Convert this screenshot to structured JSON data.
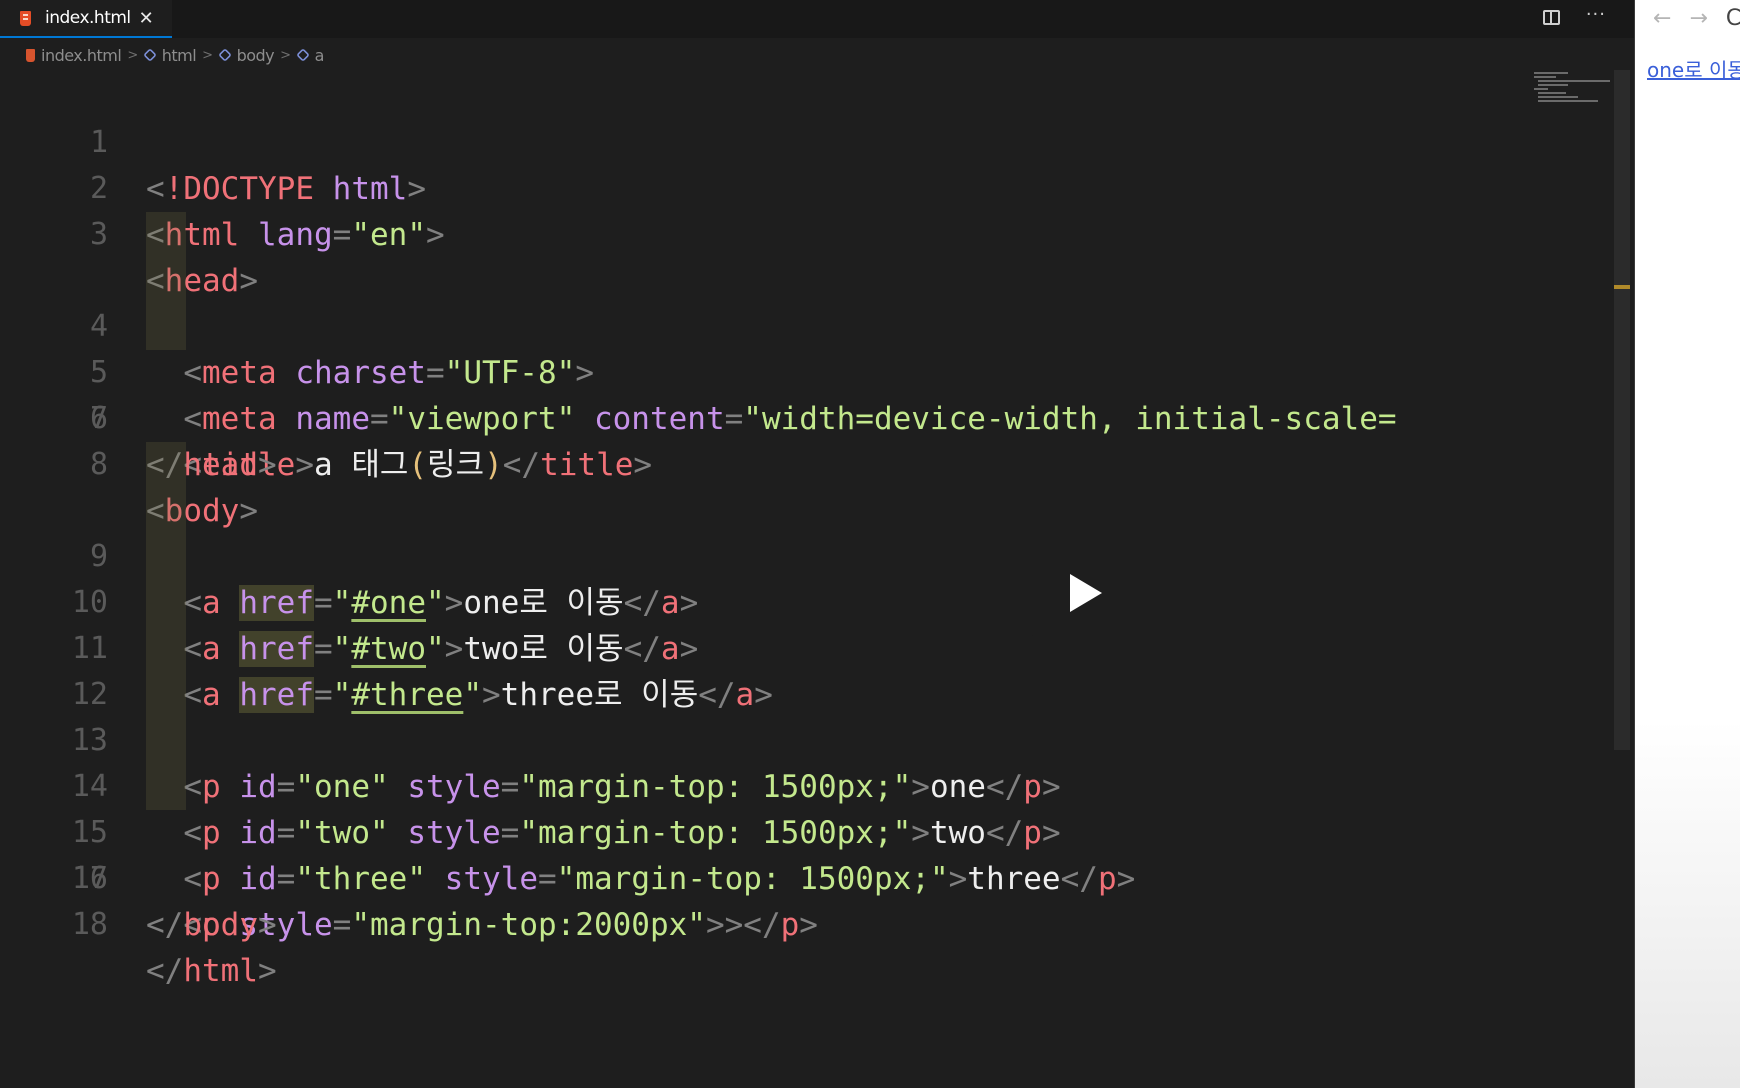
{
  "tab": {
    "filename": "index.html",
    "close_glyph": "✕"
  },
  "actions": {
    "more_glyph": "···"
  },
  "breadcrumb": {
    "file": "index.html",
    "items": [
      "html",
      "body",
      "a"
    ],
    "separator": ">"
  },
  "lines": {
    "n1": "1",
    "n2": "2",
    "n3": "3",
    "n4": "4",
    "n5": "5",
    "n6": "6",
    "n7": "7",
    "n8": "8",
    "n9": "9",
    "n10": "10",
    "n11": "11",
    "n12": "12",
    "n13": "13",
    "n14": "14",
    "n15": "15",
    "n16": "16",
    "n17": "17",
    "n18": "18"
  },
  "code": {
    "l1": {
      "lt": "<",
      "bang": "!",
      "doctype": "DOCTYPE",
      "sp": " ",
      "html": "html",
      "gt": ">"
    },
    "l2": {
      "lt": "<",
      "tag": "html",
      "sp": " ",
      "attr": "lang",
      "eq": "=",
      "val": "\"en\"",
      "gt": ">"
    },
    "l3": {
      "lt": "<",
      "tag": "head",
      "gt": ">"
    },
    "l4": {
      "lt": "<",
      "tag": "meta",
      "sp": " ",
      "attr": "charset",
      "eq": "=",
      "val": "\"UTF-8\"",
      "gt": ">"
    },
    "l5": {
      "lt": "<",
      "tag": "meta",
      "sp1": " ",
      "attr1": "name",
      "eq1": "=",
      "val1": "\"viewport\"",
      "sp2": " ",
      "attr2": "content",
      "eq2": "=",
      "val2": "\"width=device-width, initial-scale="
    },
    "l6": {
      "lt": "<",
      "tag": "title",
      "gt": ">",
      "text1": "a 태그",
      "paren_open": "(",
      "text2": "링크",
      "paren_close": ")",
      "clt": "</",
      "ctag": "title",
      "cgt": ">"
    },
    "l7": {
      "clt": "</",
      "tag": "head",
      "gt": ">"
    },
    "l8": {
      "lt": "<",
      "tag": "body",
      "gt": ">"
    },
    "l9": {
      "lt": "<",
      "tag": "a",
      "sp": " ",
      "attr": "href",
      "eq": "=",
      "q1": "\"",
      "link": "#one",
      "q2": "\"",
      "gt": ">",
      "text": "one로 이동",
      "clt": "</",
      "ctag": "a",
      "cgt": ">"
    },
    "l10": {
      "lt": "<",
      "tag": "a",
      "sp": " ",
      "attr": "href",
      "eq": "=",
      "q1": "\"",
      "link": "#two",
      "q2": "\"",
      "gt": ">",
      "text": "two로 이동",
      "clt": "</",
      "ctag": "a",
      "cgt": ">"
    },
    "l11": {
      "lt": "<",
      "tag": "a",
      "sp": " ",
      "attr": "href",
      "eq": "=",
      "q1": "\"",
      "link": "#three",
      "q2": "\"",
      "gt": ">",
      "text": "three로 이동",
      "clt": "</",
      "ctag": "a",
      "cgt": ">"
    },
    "l13": {
      "lt": "<",
      "tag": "p",
      "sp1": " ",
      "attr1": "id",
      "eq1": "=",
      "val1": "\"one\"",
      "sp2": " ",
      "attr2": "style",
      "eq2": "=",
      "val2": "\"margin-top: 1500px;\"",
      "gt": ">",
      "text": "one",
      "clt": "</",
      "ctag": "p",
      "cgt": ">"
    },
    "l14": {
      "lt": "<",
      "tag": "p",
      "sp1": " ",
      "attr1": "id",
      "eq1": "=",
      "val1": "\"two\"",
      "sp2": " ",
      "attr2": "style",
      "eq2": "=",
      "val2": "\"margin-top: 1500px;\"",
      "gt": ">",
      "text": "two",
      "clt": "</",
      "ctag": "p",
      "cgt": ">"
    },
    "l15": {
      "lt": "<",
      "tag": "p",
      "sp1": " ",
      "attr1": "id",
      "eq1": "=",
      "val1": "\"three\"",
      "sp2": " ",
      "attr2": "style",
      "eq2": "=",
      "val2": "\"margin-top: 1500px;\"",
      "gt": ">",
      "text": "three",
      "clt": "</",
      "ctag": "p",
      "cgt": ">"
    },
    "l16": {
      "lt": "<",
      "tag": "p",
      "sp": " ",
      "attr": "style",
      "eq": "=",
      "val": "\"margin-top:2000px\"",
      "gt": ">",
      "clt": "></",
      "ctag": "p",
      "cgt": ">"
    },
    "l17": {
      "clt": "</",
      "tag": "body",
      "gt": ">"
    },
    "l18": {
      "clt": "</",
      "tag": "html",
      "gt": ">"
    }
  },
  "preview": {
    "back_glyph": "←",
    "forward_glyph": "→",
    "reload_glyph": "C",
    "link_text": "one로 이동"
  },
  "colors": {
    "editor_bg": "#1e1e1e",
    "tag": "#f07178",
    "attribute": "#c792ea",
    "string": "#c3e88d",
    "keyword": "#569cd6",
    "tab_accent": "#0078d4",
    "preview_link": "#3a5fd9"
  },
  "icons": [
    "html-file-icon",
    "close-icon",
    "split-editor-icon",
    "more-actions-icon",
    "html-element-icon",
    "play-icon",
    "back-arrow-icon",
    "forward-arrow-icon",
    "reload-icon"
  ]
}
